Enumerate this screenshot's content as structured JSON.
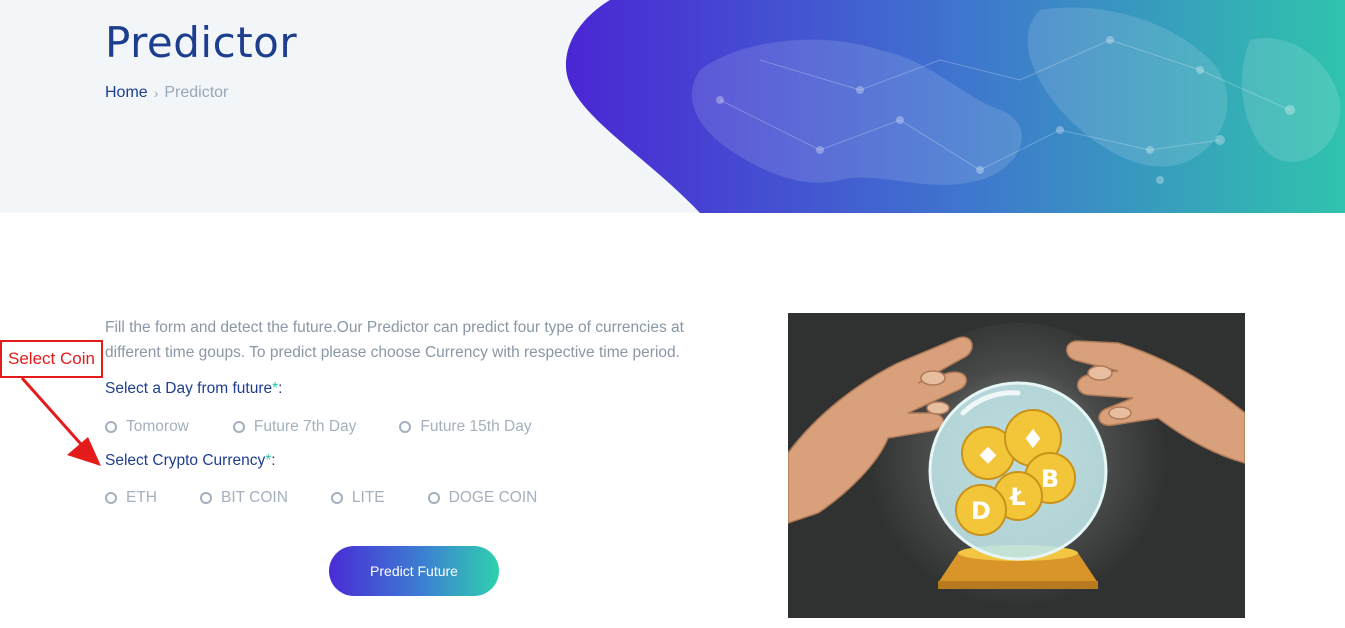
{
  "hero": {
    "title": "Predictor",
    "breadcrumb": {
      "home": "Home",
      "current": "Predictor"
    }
  },
  "intro": "Fill the form and detect the future.Our Predictor can predict four type of currencies at different time goups. To predict please choose Currency with respective time period.",
  "day_field": {
    "label": "Select a Day from future",
    "required_mark": "*",
    "suffix": ":",
    "options": [
      "Tomorow",
      "Future 7th Day",
      "Future 15th Day"
    ]
  },
  "coin_field": {
    "label": "Select Crypto Currency",
    "required_mark": "*",
    "suffix": ":",
    "options": [
      "ETH",
      "BIT COIN",
      "LITE",
      "DOGE COIN"
    ]
  },
  "predict_button": "Predict Future",
  "annotation": {
    "text": "Select Coin",
    "color": "#e31b1b"
  },
  "colors": {
    "primary": "#1d3e8f",
    "accent_teal": "#25c8b0",
    "gradient_start": "#4a2bd6",
    "gradient_end": "#2fd1ae",
    "muted": "#a4b0bd"
  }
}
